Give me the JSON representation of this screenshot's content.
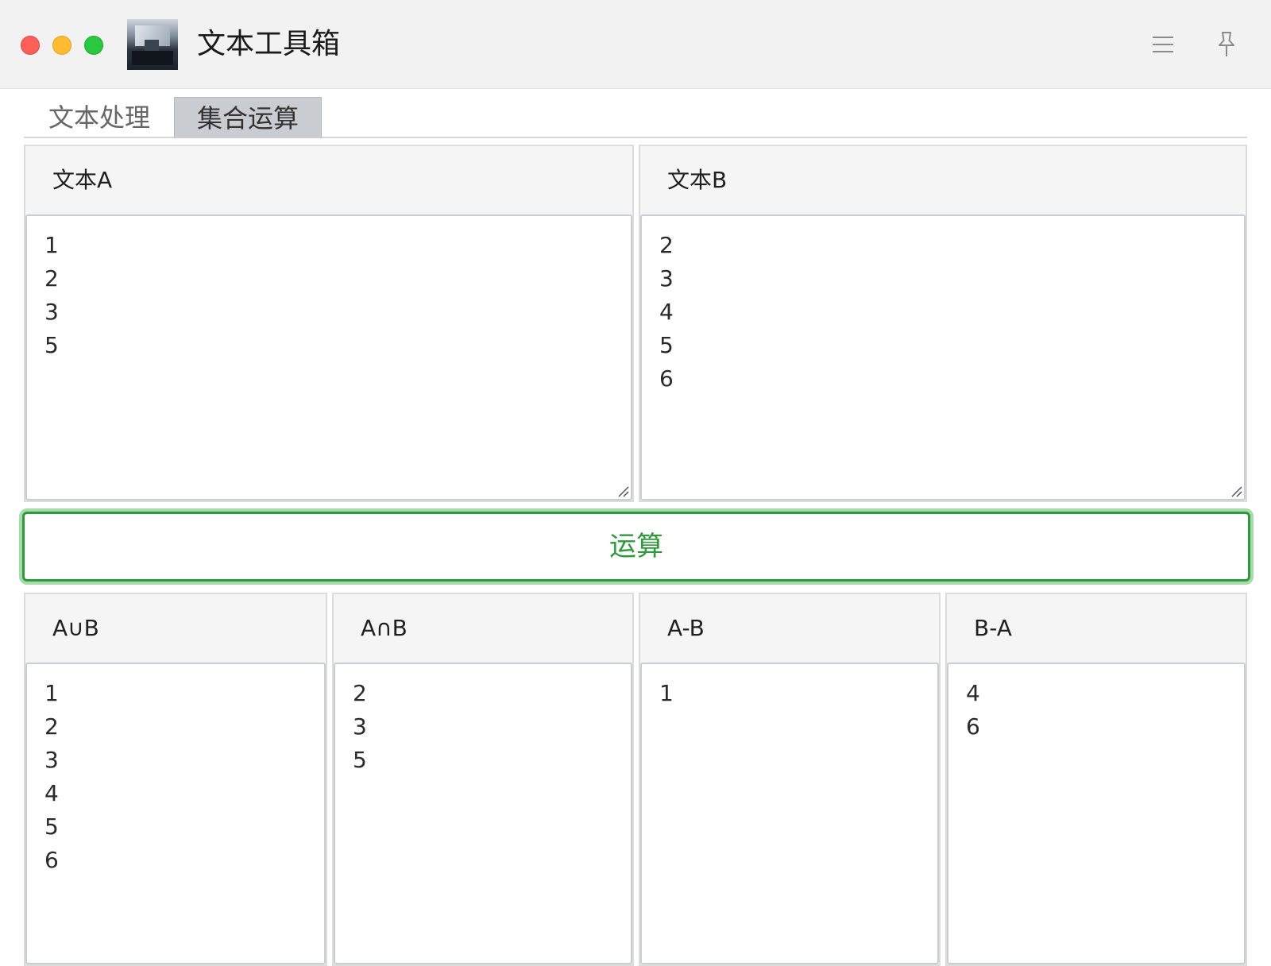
{
  "window": {
    "title": "文本工具箱",
    "icons": {
      "menu": "hamburger-menu-icon",
      "pin": "pin-icon"
    }
  },
  "tabs": [
    {
      "label": "文本处理",
      "selected": false
    },
    {
      "label": "集合运算",
      "selected": true
    }
  ],
  "inputs": {
    "text_a": {
      "label": "文本A",
      "value": "1\n2\n3\n5"
    },
    "text_b": {
      "label": "文本B",
      "value": "2\n3\n4\n5\n6"
    }
  },
  "run_button": {
    "label": "运算",
    "color": "#2e9a3c"
  },
  "results": {
    "union": {
      "label": "A∪B",
      "value": "1\n2\n3\n4\n5\n6"
    },
    "intersection": {
      "label": "A∩B",
      "value": "2\n3\n5"
    },
    "a_minus_b": {
      "label": "A-B",
      "value": "1"
    },
    "b_minus_a": {
      "label": "B-A",
      "value": "4\n6"
    }
  }
}
